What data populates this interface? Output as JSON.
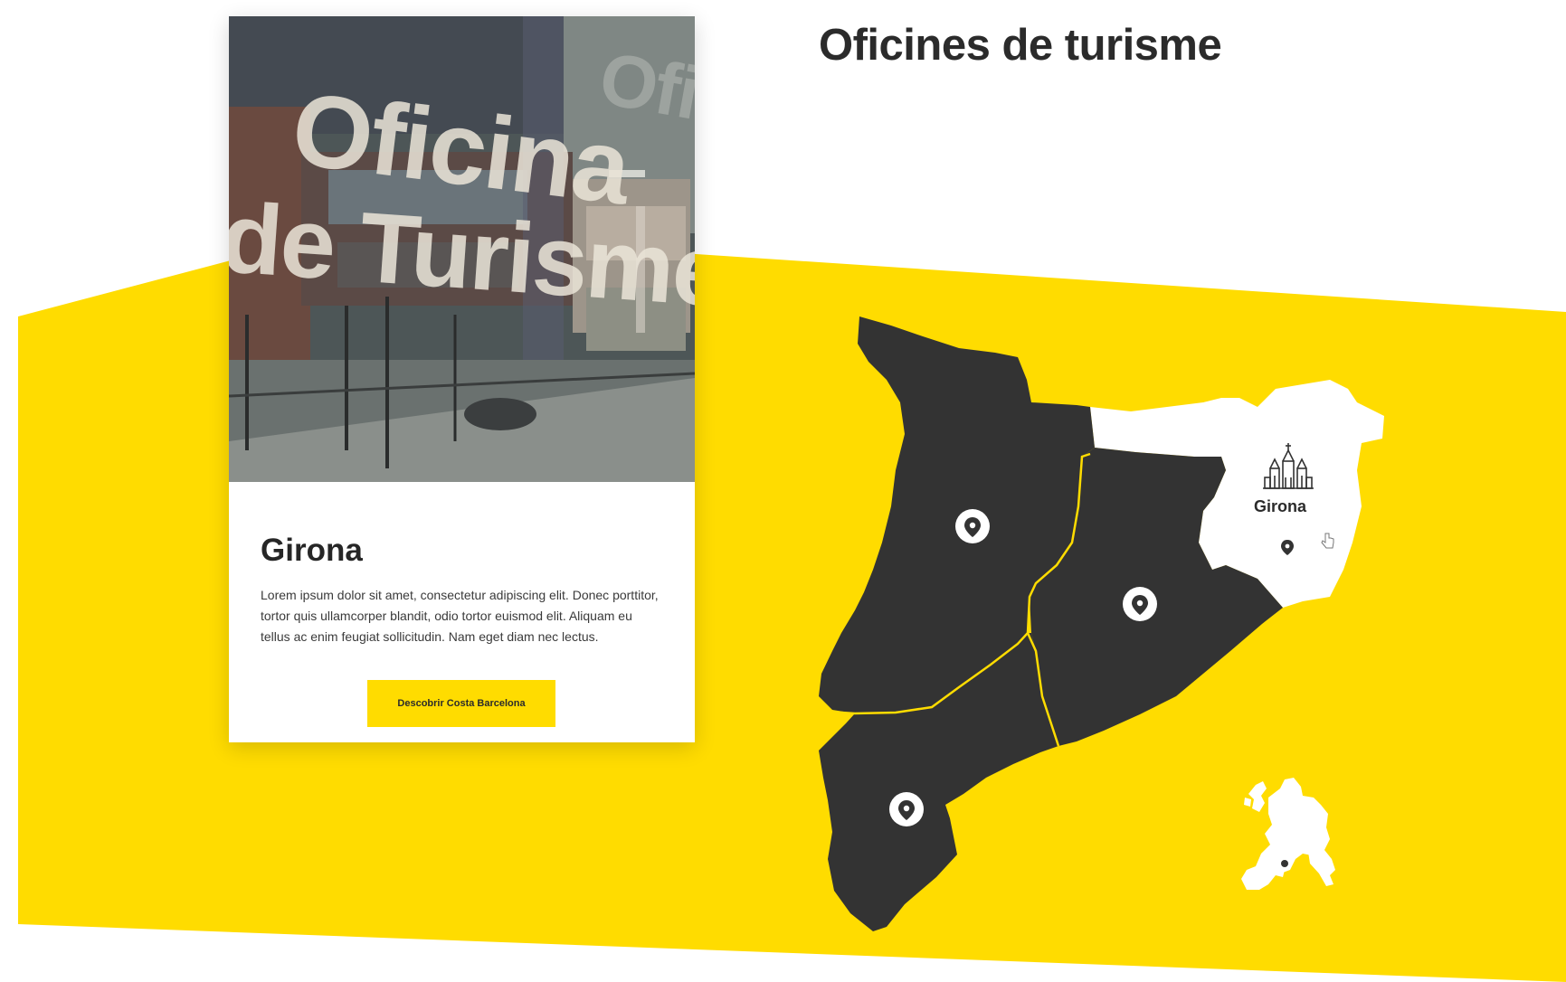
{
  "section": {
    "title": "Oficines de turisme",
    "accent_color": "#ffdc00",
    "dark_color": "#333333"
  },
  "card": {
    "photo": {
      "sign_line_1": "Oficina",
      "sign_line_2": "de Turisme",
      "sign_reflection": "Ofi"
    },
    "title": "Girona",
    "description": "Lorem ipsum dolor sit amet, consectetur adipiscing elit. Donec porttitor, tortor quis ullamcorper blandit, odio tortor euismod elit. Aliquam eu tellus ac enim feugiat sollicitudin. Nam eget diam nec lectus.",
    "button_label": "Descobrir Costa Barcelona"
  },
  "map": {
    "selected_region": "Girona",
    "regions": [
      {
        "id": "lleida",
        "state": "default",
        "color": "#333333"
      },
      {
        "id": "barcelona",
        "state": "default",
        "color": "#333333"
      },
      {
        "id": "tarragona",
        "state": "default",
        "color": "#333333"
      },
      {
        "id": "girona",
        "state": "selected",
        "color": "#ffffff"
      }
    ],
    "selected_icon": "cathedral-icon",
    "marker_icon": "location-pin-icon",
    "locator_icon": "europe-map-icon"
  }
}
